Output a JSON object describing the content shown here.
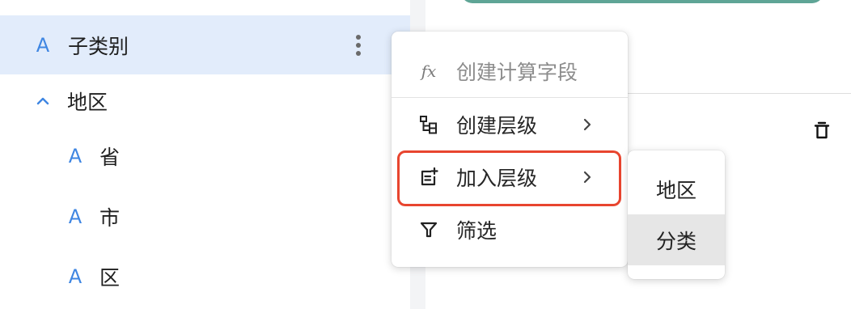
{
  "fields": {
    "selected": {
      "type": "A",
      "label": "子类别"
    },
    "group": {
      "label": "地区"
    },
    "children": [
      {
        "type": "A",
        "label": "省"
      },
      {
        "type": "A",
        "label": "市"
      },
      {
        "type": "A",
        "label": "区"
      }
    ]
  },
  "context_menu": {
    "items": [
      {
        "icon": "fx-icon",
        "label": "创建计算字段",
        "disabled": true
      },
      {
        "icon": "hierarchy-icon",
        "label": "创建层级",
        "has_submenu": true
      },
      {
        "icon": "add-to-list-icon",
        "label": "加入层级",
        "has_submenu": true,
        "highlighted": true
      },
      {
        "icon": "filter-icon",
        "label": "筛选"
      }
    ],
    "fx_glyph": "fx"
  },
  "submenu": {
    "items": [
      {
        "label": "地区"
      },
      {
        "label": "分类",
        "active": true
      }
    ]
  },
  "colors": {
    "accent_blue": "#3f86e2",
    "selected_row": "#e2ecfb",
    "highlight_border": "#e8452f",
    "teal": "#5fa596"
  }
}
